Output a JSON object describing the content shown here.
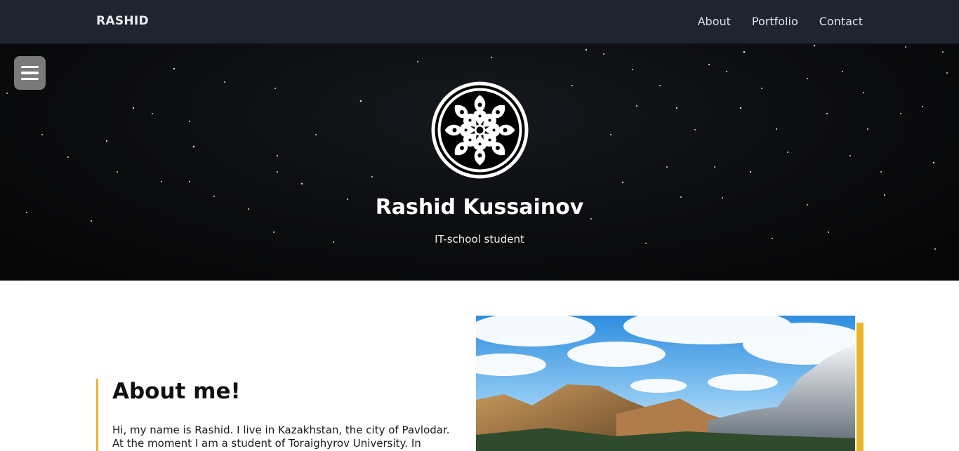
{
  "navbar": {
    "brand": "RASHID",
    "links": [
      {
        "label": "About"
      },
      {
        "label": "Portfolio"
      },
      {
        "label": "Contact"
      }
    ]
  },
  "hero": {
    "name": "Rashid Kussainov",
    "subtitle": "IT-school student",
    "menu_icon": "hamburger-menu-icon",
    "logo_icon": "ornamental-medallion-logo"
  },
  "about": {
    "title": "About me!",
    "text": "Hi, my name is Rashid. I live in Kazakhstan, the city of Pavlodar. At the moment I am a student of Toraighyrov University. In parallel, I"
  },
  "colors": {
    "navbar_bg": "#1f252e",
    "accent": "#e8b42a",
    "hero_bg": "#0b0c0e"
  }
}
